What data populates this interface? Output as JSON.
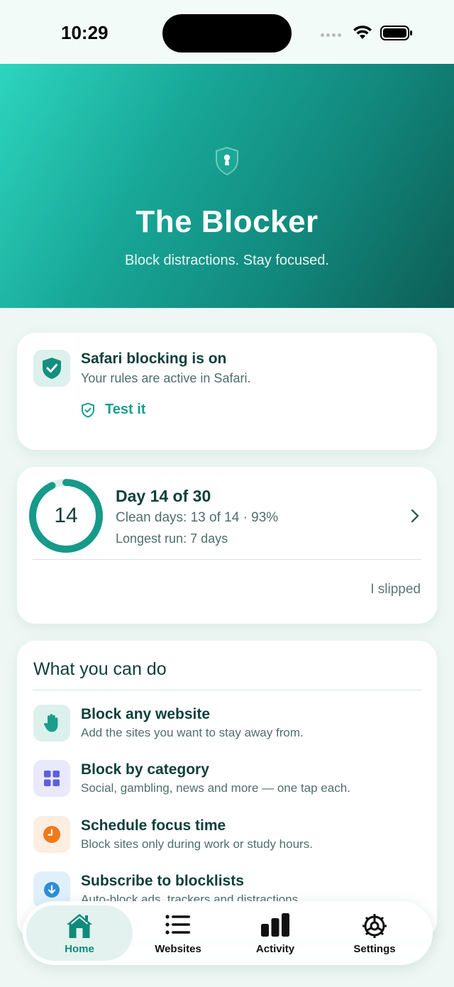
{
  "status_bar": {
    "time": "10:29"
  },
  "hero": {
    "title": "The Blocker",
    "subtitle": "Block distractions. Stay focused.",
    "icon": "shield-keyhole-icon"
  },
  "safari_card": {
    "title": "Safari blocking is on",
    "subtitle": "Your rules are active in Safari.",
    "action_label": "Test it",
    "icon": "shield-check-icon"
  },
  "streak_card": {
    "ring_value": "14",
    "progress": 0.93,
    "title": "Day 14 of 30",
    "clean_days": "Clean days: 13 of 14 · 93%",
    "longest_run": "Longest run: 7 days",
    "slipped_label": "I slipped"
  },
  "features": {
    "title": "What you can do",
    "items": [
      {
        "title": "Block any website",
        "subtitle": "Add the sites you want to stay away from.",
        "icon": "hand-stop-icon",
        "color": "#1b9d8c"
      },
      {
        "title": "Block by category",
        "subtitle": "Social, gambling, news and more — one tap each.",
        "icon": "grid-icon",
        "color": "#5b5fe0"
      },
      {
        "title": "Schedule focus time",
        "subtitle": "Block sites only during work or study hours.",
        "icon": "clock-icon",
        "color": "#f07a1a"
      },
      {
        "title": "Subscribe to blocklists",
        "subtitle": "Auto-block ads, trackers and distractions.",
        "icon": "download-circle-icon",
        "color": "#2a8fd8"
      }
    ]
  },
  "tabbar": {
    "tabs": [
      {
        "label": "Home",
        "icon": "home-icon",
        "active": true
      },
      {
        "label": "Websites",
        "icon": "list-icon",
        "active": false
      },
      {
        "label": "Activity",
        "icon": "bar-chart-icon",
        "active": false
      },
      {
        "label": "Settings",
        "icon": "gear-icon",
        "active": false
      }
    ]
  },
  "colors": {
    "accent": "#1b9d8c",
    "hero_start": "#2dd5bd",
    "hero_end": "#0d5e57"
  }
}
